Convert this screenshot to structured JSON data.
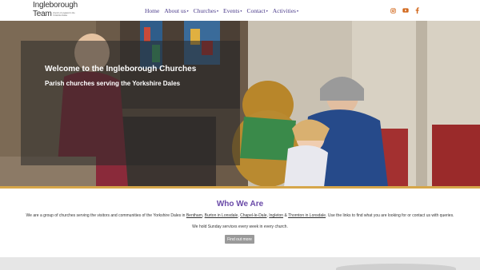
{
  "logo": {
    "line1": "Ingleborough",
    "line2": "Team",
    "tagline": "church of england in the Yorkshire Dales"
  },
  "nav": {
    "items": [
      {
        "label": "Home",
        "dropdown": false
      },
      {
        "label": "About us",
        "dropdown": true
      },
      {
        "label": "Churches",
        "dropdown": true
      },
      {
        "label": "Events",
        "dropdown": true
      },
      {
        "label": "Contact",
        "dropdown": true
      },
      {
        "label": "Activities",
        "dropdown": true
      }
    ],
    "caret": "▾"
  },
  "social": {
    "icons": [
      "instagram-icon",
      "youtube-icon",
      "facebook-icon"
    ],
    "color": "#d2691e"
  },
  "hero": {
    "title": "Welcome to the Ingleborough Churches",
    "subtitle": "Parish churches serving the Yorkshire Dales",
    "accent": "#d6a64a"
  },
  "who": {
    "title": "Who We Are",
    "intro": "We are a group of churches serving the visitors and communities of the Yorkshire Dales in",
    "links": [
      "Bentham",
      "Burton in Lonsdale",
      "Chapel-le-Dale",
      "Ingleton",
      "Thornton in Lonsdale"
    ],
    "sep_comma": ",",
    "sep_and": "&",
    "outro": ". Use the links to find what you are looking for or contact us with queries.",
    "sunday": "We hold Sunday services every week in every church.",
    "button": "Find out more",
    "title_color": "#6a4aa8"
  }
}
